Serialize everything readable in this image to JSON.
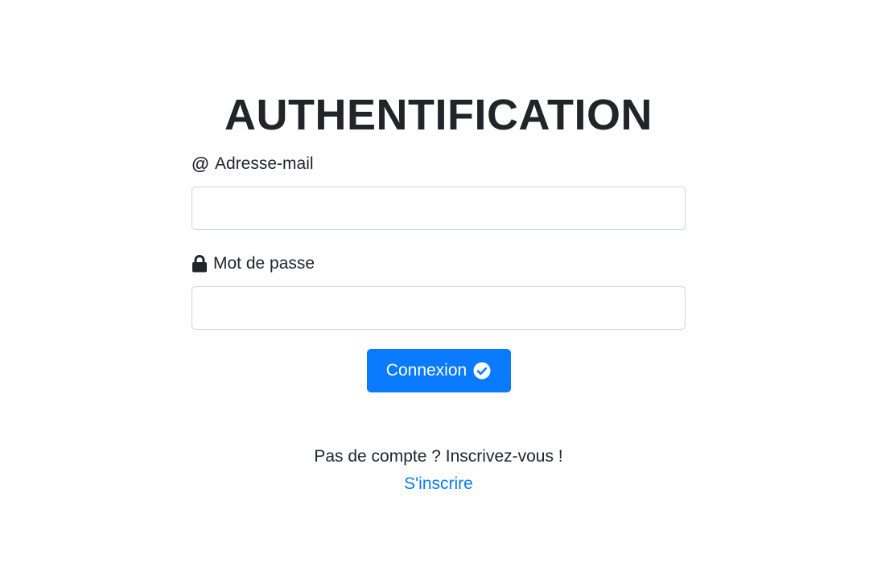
{
  "page": {
    "title": "AUTHENTIFICATION"
  },
  "form": {
    "email": {
      "icon": "at-sign-icon",
      "label": "Adresse-mail",
      "value": "",
      "placeholder": ""
    },
    "password": {
      "icon": "lock-icon",
      "label": "Mot de passe",
      "value": "",
      "placeholder": ""
    },
    "submit": {
      "label": "Connexion",
      "icon": "check-circle-icon",
      "color": "#0a7bff"
    }
  },
  "signup": {
    "prompt": "Pas de compte ? Inscrivez-vous !",
    "link_label": "S'inscrire",
    "link_color": "#0a7bff"
  }
}
